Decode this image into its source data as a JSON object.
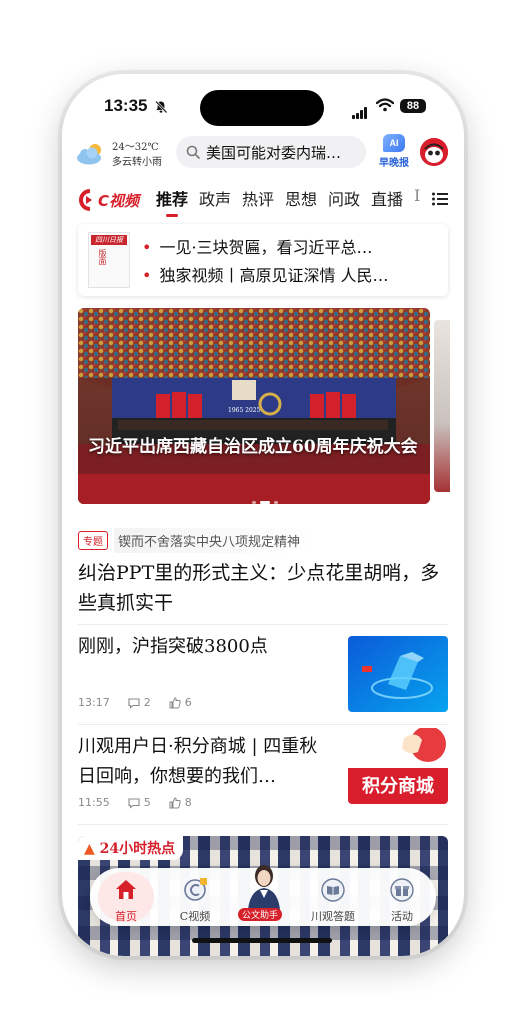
{
  "status": {
    "time": "13:35",
    "battery": "88"
  },
  "weather": {
    "temp": "24～32℃",
    "condition": "多云转小雨"
  },
  "search": {
    "text": "美国可能对委内瑞…"
  },
  "ai": {
    "badge": "AI",
    "label": "早晚报"
  },
  "tabs": {
    "logo": "C视频",
    "items": [
      "推荐",
      "政声",
      "热评",
      "思想",
      "问政",
      "直播",
      "I"
    ]
  },
  "paper": {
    "masthead": "四川日报",
    "sub": "版面",
    "lines": [
      "一见·三块贺匾，看习近平总…",
      "独家视频丨高原见证深情 人民…"
    ]
  },
  "hero": {
    "caption": "习近平出席西藏自治区成立60周年庆祝大会",
    "banner_years": "1965  2025"
  },
  "topic": {
    "tag": "专题",
    "text": "锲而不舍落实中央八项规定精神"
  },
  "headline": "纠治PPT里的形式主义：少点花里胡哨，多些真抓实干",
  "news": [
    {
      "title": "刚刚，沪指突破3800点",
      "time": "13:17",
      "comments": "2",
      "likes": "6"
    },
    {
      "title": "川观用户日·积分商城 | 四重秋日回响，你想要的我们…",
      "time": "11:55",
      "comments": "5",
      "likes": "8",
      "thumb_text": "积分商城"
    }
  ],
  "hot": {
    "title": "24小时热点"
  },
  "bottomnav": {
    "items": [
      "首页",
      "C视频",
      "公文助手",
      "川观答题",
      "活动"
    ]
  },
  "colors": {
    "accent": "#d6202a",
    "ai_blue": "#2a63d8"
  }
}
